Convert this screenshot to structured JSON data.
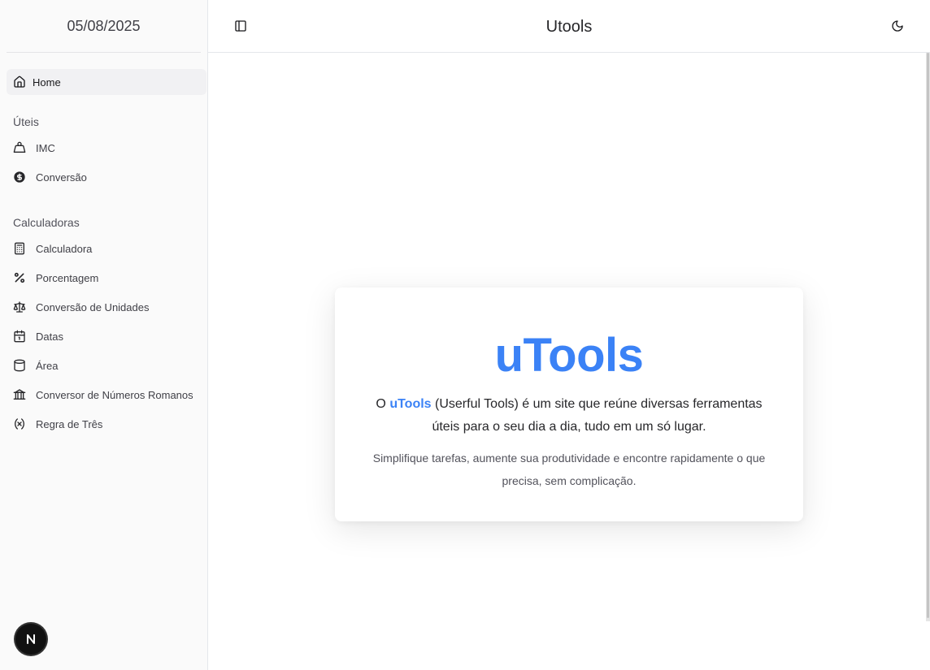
{
  "sidebar": {
    "date": "05/08/2025",
    "home_label": "Home",
    "groups": [
      {
        "label": "Úteis",
        "items": [
          {
            "label": "IMC",
            "icon": "weight-icon"
          },
          {
            "label": "Conversão",
            "icon": "dollar-circle-icon"
          }
        ]
      },
      {
        "label": "Calculadoras",
        "items": [
          {
            "label": "Calculadora",
            "icon": "calculator-icon"
          },
          {
            "label": "Porcentagem",
            "icon": "percent-icon"
          },
          {
            "label": "Conversão de Unidades",
            "icon": "scale-icon"
          },
          {
            "label": "Datas",
            "icon": "calendar-icon"
          },
          {
            "label": "Área",
            "icon": "cylinder-icon"
          },
          {
            "label": "Conversor de Números Romanos",
            "icon": "roman-icon"
          },
          {
            "label": "Regra de Três",
            "icon": "variable-icon"
          }
        ]
      }
    ],
    "badge_letter": "N"
  },
  "header": {
    "title": "Utools"
  },
  "card": {
    "title": "uTools",
    "desc_prefix": "O ",
    "desc_brand": "uTools",
    "desc_suffix": " (Userful Tools) é um site que reúne diversas ferramentas úteis para o seu dia a dia, tudo em um só lugar.",
    "sub": "Simplifique tarefas, aumente sua produtividade e encontre rapidamente o que precisa, sem complicação."
  },
  "colors": {
    "accent": "#3b82f6",
    "sidebar_bg": "#fafafa"
  }
}
